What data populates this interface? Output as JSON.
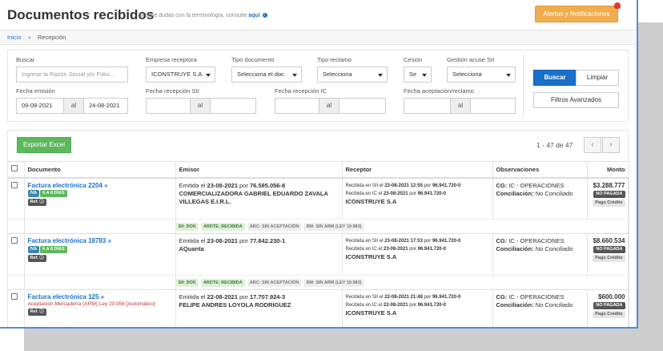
{
  "header": {
    "title": "Documentos recibidos",
    "subtitle": "Si tiene dudas con la terminología, consulte",
    "subtitle_link": "aquí",
    "alerts_button": "Alertas y Notificaciones"
  },
  "breadcrumb": {
    "home": "Inicio",
    "separator": "»",
    "current": "Recepción"
  },
  "filters": {
    "buscar_label": "Buscar",
    "buscar_placeholder": "Ingrese la Razón Social y/o Folio...",
    "empresa_label": "Empresa receptora",
    "empresa_value": "ICONSTRUYE S.A.",
    "tipo_doc_label": "Tipo documento",
    "tipo_doc_value": "Selecciona el doc",
    "tipo_reclamo_label": "Tipo reclamo",
    "tipo_reclamo_value": "Selecciona",
    "cesion_label": "Cesión",
    "cesion_value": "Se",
    "acuse_label": "Gestión acuse SII",
    "acuse_value": "Selecciona",
    "buscar_button": "Buscar",
    "limpiar_button": "Limpiar",
    "avanzados_button": "Filtros Avanzados",
    "fecha_emision_label": "Fecha emisión",
    "fecha_emision_from": "09-08-2021",
    "fecha_emision_to": "24-08-2021",
    "al": "al",
    "fecha_sii_label": "Fecha recepción SII",
    "fecha_ic_label": "Fecha recepción IC",
    "fecha_aceptacion_label": "Fecha aceptación/reclamo"
  },
  "results": {
    "export_button": "Exportar Excel",
    "pager_text": "1 - 47 de 47",
    "prev": "‹",
    "next": "›",
    "columns": [
      "Documento",
      "Emisor",
      "Receptor",
      "Observaciones",
      "Monto"
    ],
    "rows": [
      {
        "doc": "Factura electrónica 2204 »",
        "tags": [
          "IVA",
          "6 A 8 DÍAS"
        ],
        "ref": "Ref.",
        "arm": "",
        "emisor_prefix": "Emitida el",
        "emisor_date": "23-08-2021",
        "emisor_por": "por",
        "emisor_rut": "76.585.056-8",
        "emisor_name": "COMERCIALIZADORA GABRIEL EDUARDO ZAVALA VILLEGAS E.I.R.L.",
        "receptor_sii": "Recibida en SII el",
        "receptor_sii_date": "23-08-2021 12:55",
        "receptor_sii_rut": "96.941.720-0",
        "receptor_ic": "Recibida en IC el",
        "receptor_ic_date": "23-08-2021",
        "receptor_ic_rut": "96.941.720-0",
        "por": "por",
        "receptor_name": "ICONSTRUYE S.A",
        "cg_label": "CG:",
        "cg_value": "IC - OPERACIONES",
        "conc_label": "Conciliación:",
        "conc_value": "No Conciliado",
        "monto": "$3.288.777",
        "estado": "NO PAGADA",
        "pago": "Pago Crédito",
        "status": [
          "SII: DOK",
          "ARDTE: RECIBIDA",
          "ARC: SIN ACEPTACIÓN",
          "RM: SIN ARM (LEY 19.983)"
        ]
      },
      {
        "doc": "Factura electrónica 18783 »",
        "tags": [
          "IVA",
          "6 A 8 DÍAS"
        ],
        "ref": "Ref.",
        "arm": "",
        "emisor_prefix": "Emitida el",
        "emisor_date": "23-08-2021",
        "emisor_por": "por",
        "emisor_rut": "77.842.230-1",
        "emisor_name": "AQuanta",
        "receptor_sii": "Recibida en SII el",
        "receptor_sii_date": "23-08-2021 17:53",
        "receptor_sii_rut": "96.941.720-0",
        "receptor_ic": "Recibida en IC el",
        "receptor_ic_date": "23-08-2021",
        "receptor_ic_rut": "96.941.720-0",
        "por": "por",
        "receptor_name": "ICONSTRUYE S.A",
        "cg_label": "CG:",
        "cg_value": "IC - OPERACIONES",
        "conc_label": "Conciliación:",
        "conc_value": "No Conciliado",
        "monto": "$8.660.534",
        "estado": "NO PAGADA",
        "pago": "Pago Crédito",
        "status": [
          "SII: DOK",
          "ARDTE: RECIBIDA",
          "ARC: SIN ACEPTACIÓN",
          "RM: SIN ARM (LEY 19.983)"
        ]
      },
      {
        "doc": "Factura electrónica 125 »",
        "tags": [],
        "ref": "Ref.",
        "arm": "Aceptación Mercadería (ARM) Ley 20.956 [Automático]",
        "emisor_prefix": "Emitida el",
        "emisor_date": "22-08-2021",
        "emisor_por": "por",
        "emisor_rut": "17.707.924-3",
        "emisor_name": "FELIPE ANDRES LOYOLA RODRIGUEZ",
        "receptor_sii": "Recibida en SII el",
        "receptor_sii_date": "22-08-2021 21:48",
        "receptor_sii_rut": "96.941.720-0",
        "receptor_ic": "Recibida en IC el",
        "receptor_ic_date": "22-08-2021",
        "receptor_ic_rut": "96.941.720-0",
        "por": "por",
        "receptor_name": "ICONSTRUYE S.A",
        "cg_label": "CG:",
        "cg_value": "IC - OPERACIONES",
        "conc_label": "Conciliación:",
        "conc_value": "No Conciliado",
        "monto": "$600.000",
        "estado": "NO PAGADA",
        "pago": "Pago Crédito",
        "status": []
      }
    ]
  }
}
